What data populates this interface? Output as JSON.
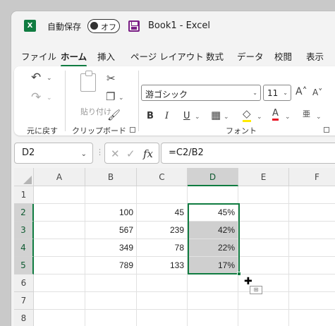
{
  "title_bar": {
    "app_logo": "X",
    "autosave_label": "自動保存",
    "autosave_state": "オフ",
    "document_title": "Book1  -  Excel"
  },
  "tabs": [
    "ファイル",
    "ホーム",
    "挿入",
    "ページ レイアウト",
    "数式",
    "データ",
    "校閲",
    "表示"
  ],
  "active_tab": "ホーム",
  "ribbon": {
    "undo_group_label": "元に戻す",
    "clipboard_group_label": "クリップボード",
    "paste_label": "貼り付け",
    "font_group_label": "フォント",
    "font_name": "游ゴシック",
    "font_size": "11",
    "bold": "B",
    "italic": "I",
    "underline": "U"
  },
  "formula_bar": {
    "name_box": "D2",
    "fx_label": "fx",
    "formula": "=C2/B2"
  },
  "sheet": {
    "columns": [
      "A",
      "B",
      "C",
      "D",
      "E",
      "F"
    ],
    "rows": [
      "1",
      "2",
      "3",
      "4",
      "5",
      "6",
      "7",
      "8"
    ],
    "cells": {
      "B2": "100",
      "C2": "45",
      "D2": "45%",
      "B3": "567",
      "C3": "239",
      "D3": "42%",
      "B4": "349",
      "C4": "78",
      "D4": "22%",
      "B5": "789",
      "C5": "133",
      "D5": "17%"
    },
    "selected_range": "D2:D5"
  },
  "colors": {
    "excel_green": "#107c41",
    "selection_fill": "#cfcfcf"
  }
}
